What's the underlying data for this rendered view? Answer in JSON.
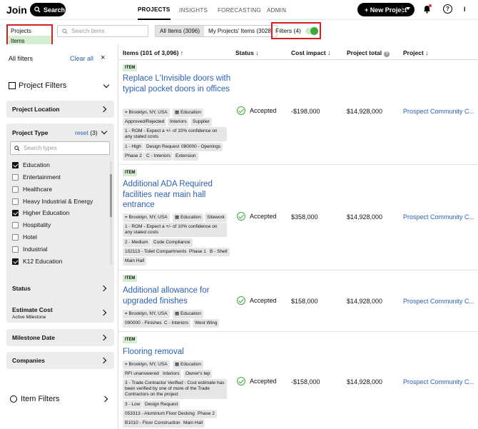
{
  "topbar": {
    "logo": "Join",
    "search_label": "Search",
    "nav": [
      "PROJECTS",
      "INSIGHTS",
      "FORECASTING",
      "ADMIN"
    ],
    "new_project_label": "+ New Project",
    "help_glyph": "?",
    "user_initial": "I"
  },
  "toolbar": {
    "mode_options": [
      "Projects",
      "Items"
    ],
    "search_placeholder": "Search items",
    "all_items": "All Items (3096)",
    "my_items": "My Projects' Items (3028)",
    "filters_label": "Filters (4)"
  },
  "sidebar": {
    "all_filters": "All filters",
    "clear_all": "Clear all",
    "close_glyph": "×",
    "project_filters": "Project Filters",
    "project_location": "Project Location",
    "project_type": "Project Type",
    "reset": "reset",
    "reset_count": "(3)",
    "type_search_placeholder": "Search types",
    "types": [
      {
        "label": "Education",
        "checked": true
      },
      {
        "label": "Entertainment",
        "checked": false
      },
      {
        "label": "Healthcare",
        "checked": false
      },
      {
        "label": "Heavy Industrial & Energy",
        "checked": false
      },
      {
        "label": "Higher Education",
        "checked": true
      },
      {
        "label": "Hospitality",
        "checked": false
      },
      {
        "label": "Hotel",
        "checked": false
      },
      {
        "label": "Industrial",
        "checked": false
      },
      {
        "label": "K12 Education",
        "checked": true
      }
    ],
    "status": "Status",
    "estimate_cost": "Estimate Cost",
    "estimate_sub": "Active Milestone",
    "milestone_date": "Milestone Date",
    "companies": "Companies",
    "item_filters": "Item Filters"
  },
  "table": {
    "headers": {
      "items": "Items (101 of 3,096) ↑",
      "status": "Status ↓",
      "cost": "Cost impact ↓",
      "total": "Project total",
      "project": "Project ↓"
    },
    "rows": [
      {
        "badge": "ITEM",
        "title": "Replace L'Invisible doors with typical pocket doors in offices",
        "tags": [
          "Brooklyn, NY, USA",
          "Education",
          "Approved/Rejected",
          "Interiors",
          "Supplier",
          "1 - ROM - Expect a +/- of 10% confidence on any stated costs",
          "1 - High",
          "Design Request",
          "080000 - Openings",
          "Phase 2",
          "C - Interiors",
          "Extension"
        ],
        "status": "Accepted",
        "cost": "-$198,000",
        "total": "$14,928,000",
        "project": "Prospect Community C..."
      },
      {
        "badge": "ITEM",
        "title": "Additional ADA Required facilities near main hall entrance",
        "tags": [
          "Brooklyn, NY, USA",
          "Education",
          "Sitework",
          "1 - ROM - Expect a +/- of 10% confidence on any stated costs",
          "2 - Medium",
          "Code Compliance",
          "102113 - Toilet Compartments",
          "Phase 1",
          "B - Shell",
          "Main Hall"
        ],
        "status": "Accepted",
        "cost": "$358,000",
        "total": "$14,928,000",
        "project": "Prospect Community C..."
      },
      {
        "badge": "ITEM",
        "title": "Additional allowance for upgraded finishes",
        "tags": [
          "Brooklyn, NY, USA",
          "Education",
          "090000 - Finishes",
          "C - Interiors",
          "West Wing"
        ],
        "status": "Accepted",
        "cost": "$158,000",
        "total": "$14,928,000",
        "project": "Prospect Community C..."
      },
      {
        "badge": "ITEM",
        "title": "Flooring removal",
        "tags": [
          "Brooklyn, NY, USA",
          "Education",
          "RFI unanswered",
          "Interiors",
          "Owner's tep",
          "3 - Trade Contractor Verified - Cost estimate has been verified by one of more of the Trade Contractors on the project",
          "3 - Low",
          "Design Request",
          "053313 - Aluminum Floor Decking",
          "Phase 2",
          "B1010 - Floor Construction",
          "Main Hall"
        ],
        "status": "Accepted",
        "cost": "-$158,000",
        "total": "$14,928,000",
        "project": "Prospect Community C..."
      }
    ]
  }
}
